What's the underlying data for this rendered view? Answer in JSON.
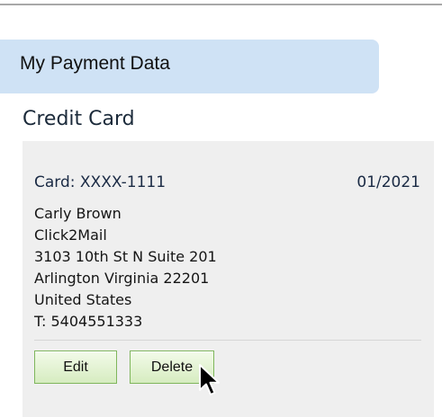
{
  "section": {
    "title": "My Payment Data"
  },
  "credit_card": {
    "heading": "Credit Card",
    "card_number": "Card: XXXX-1111",
    "expiry": "01/2021",
    "address": {
      "name": "Carly Brown",
      "company": "Click2Mail",
      "street": "3103 10th St N Suite 201",
      "city_state_zip": "Arlington Virginia 22201",
      "country": "United States",
      "phone": "T: 5404551333"
    }
  },
  "actions": {
    "edit_label": "Edit",
    "delete_label": "Delete"
  },
  "icons": {
    "cursor": "mouse-pointer-icon"
  },
  "colors": {
    "header_background": "#cfe2f5",
    "panel_background": "#efefef",
    "button_border": "#7fb65c",
    "button_fill": "#d6ecc0"
  }
}
